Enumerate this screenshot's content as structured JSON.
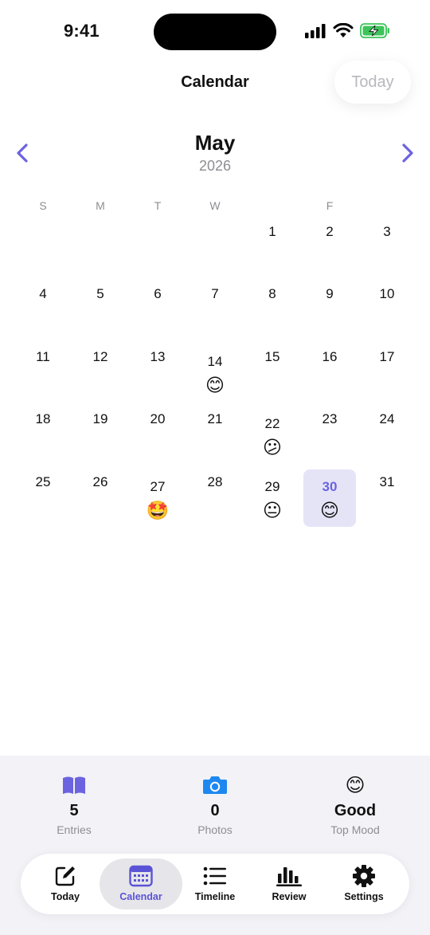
{
  "status_bar": {
    "time": "9:41"
  },
  "header": {
    "title": "Calendar",
    "today_button": "Today"
  },
  "month": {
    "name": "May",
    "year": "2026"
  },
  "weekdays": [
    "S",
    "M",
    "T",
    "W",
    "",
    "F",
    ""
  ],
  "days": [
    {
      "n": "1"
    },
    {
      "n": "2"
    },
    {
      "n": "3"
    },
    {
      "n": "4"
    },
    {
      "n": "5"
    },
    {
      "n": "6"
    },
    {
      "n": "7"
    },
    {
      "n": "8"
    },
    {
      "n": "9"
    },
    {
      "n": "10"
    },
    {
      "n": "11"
    },
    {
      "n": "12"
    },
    {
      "n": "13"
    },
    {
      "n": "14",
      "mood": "😊"
    },
    {
      "n": "15"
    },
    {
      "n": "16"
    },
    {
      "n": "17"
    },
    {
      "n": "18"
    },
    {
      "n": "19"
    },
    {
      "n": "20"
    },
    {
      "n": "21"
    },
    {
      "n": "22",
      "mood": "😕"
    },
    {
      "n": "23"
    },
    {
      "n": "24"
    },
    {
      "n": "25"
    },
    {
      "n": "26"
    },
    {
      "n": "27",
      "mood": "🤩"
    },
    {
      "n": "28"
    },
    {
      "n": "29",
      "mood": "😐"
    },
    {
      "n": "30",
      "mood": "😊",
      "selected": true
    },
    {
      "n": "31"
    }
  ],
  "summary": {
    "entries": {
      "value": "5",
      "label": "Entries",
      "icon": "book-icon"
    },
    "photos": {
      "value": "0",
      "label": "Photos",
      "icon": "camera-icon"
    },
    "mood": {
      "value": "Good",
      "label": "Top Mood",
      "emoji": "😊"
    }
  },
  "tabs": [
    {
      "label": "Today",
      "icon": "compose-icon"
    },
    {
      "label": "Calendar",
      "icon": "calendar-icon",
      "active": true
    },
    {
      "label": "Timeline",
      "icon": "list-icon"
    },
    {
      "label": "Review",
      "icon": "chart-icon"
    },
    {
      "label": "Settings",
      "icon": "gear-icon"
    }
  ],
  "colors": {
    "accent": "#6b63e0",
    "selected_bg": "#e5e4f7",
    "camera": "#1e88f0",
    "panel_bg": "#f2f2f7"
  }
}
